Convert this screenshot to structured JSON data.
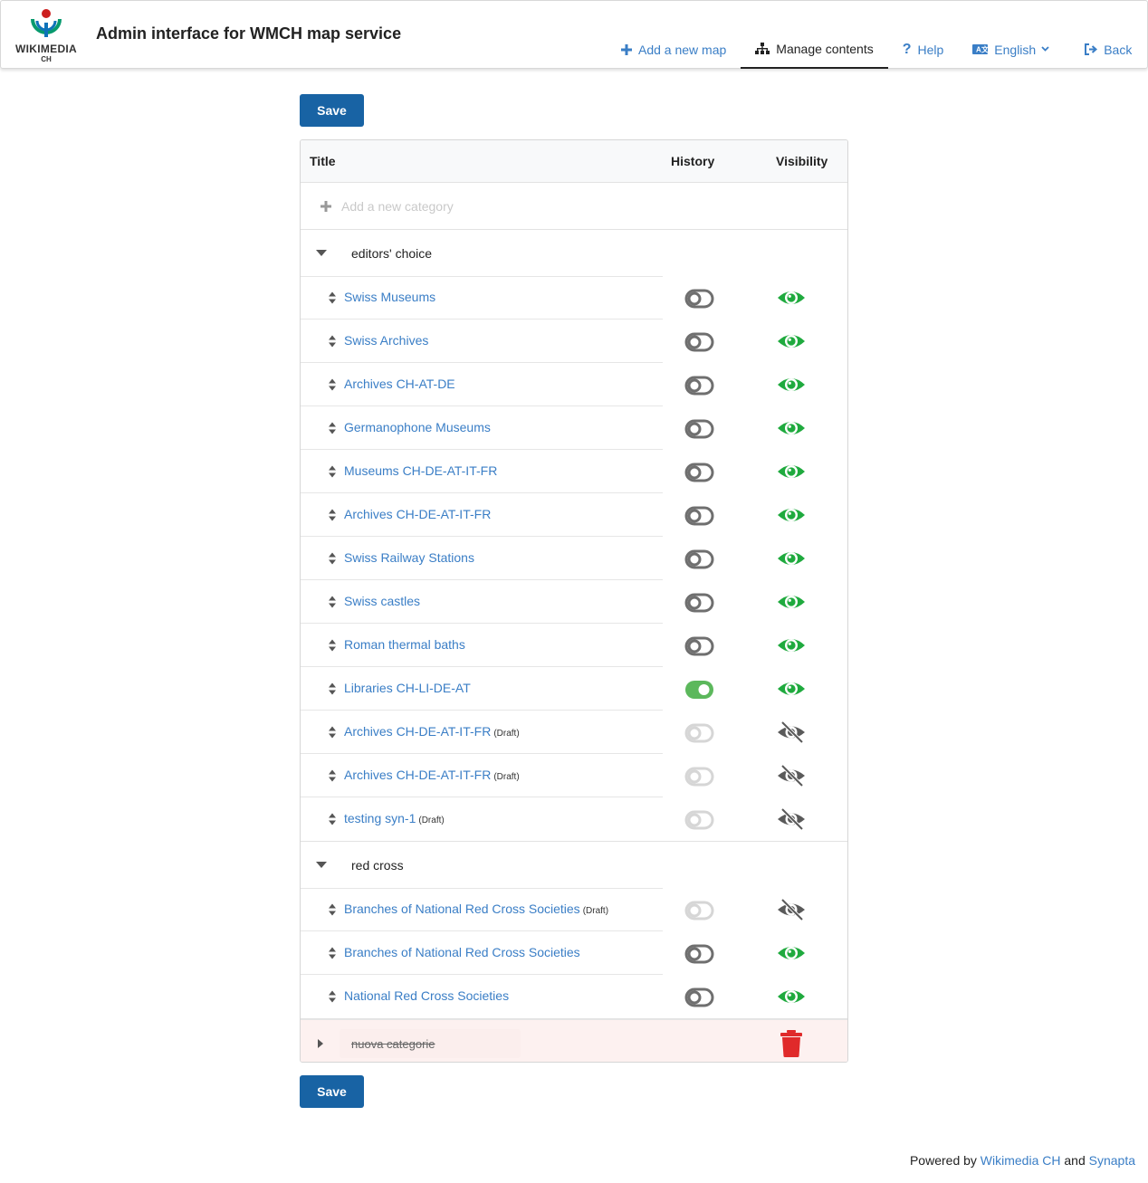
{
  "header": {
    "logo_text": "WIKIMEDIA",
    "logo_sub": "CH",
    "title": "Admin interface for WMCH map service",
    "nav": {
      "add_map": "Add a new map",
      "manage": "Manage contents",
      "help": "Help",
      "language": "English",
      "back": "Back"
    }
  },
  "save_label": "Save",
  "table": {
    "col_title": "Title",
    "col_history": "History",
    "col_visibility": "Visibility",
    "add_placeholder": "Add a new category"
  },
  "categories": [
    {
      "name": "editors' choice",
      "items": [
        {
          "title": "Swiss Museums",
          "draft": "",
          "history": "off",
          "visible": true
        },
        {
          "title": "Swiss Archives",
          "draft": "",
          "history": "off",
          "visible": true
        },
        {
          "title": "Archives CH-AT-DE",
          "draft": "",
          "history": "off",
          "visible": true
        },
        {
          "title": "Germanophone Museums",
          "draft": "",
          "history": "off",
          "visible": true
        },
        {
          "title": "Museums CH-DE-AT-IT-FR",
          "draft": "",
          "history": "off",
          "visible": true
        },
        {
          "title": "Archives CH-DE-AT-IT-FR",
          "draft": "",
          "history": "off",
          "visible": true
        },
        {
          "title": "Swiss Railway Stations",
          "draft": "",
          "history": "off",
          "visible": true
        },
        {
          "title": "Swiss castles",
          "draft": "",
          "history": "off",
          "visible": true
        },
        {
          "title": "Roman thermal baths",
          "draft": "",
          "history": "off",
          "visible": true
        },
        {
          "title": "Libraries CH-LI-DE-AT",
          "draft": "",
          "history": "on",
          "visible": true
        },
        {
          "title": "Archives CH-DE-AT-IT-FR",
          "draft": "(Draft)",
          "history": "disabled",
          "visible": false
        },
        {
          "title": "Archives CH-DE-AT-IT-FR",
          "draft": "(Draft)",
          "history": "disabled",
          "visible": false
        },
        {
          "title": "testing syn-1",
          "draft": "(Draft)",
          "history": "disabled",
          "visible": false
        }
      ]
    },
    {
      "name": "red cross",
      "items": [
        {
          "title": "Branches of National Red Cross Societies",
          "draft": "(Draft)",
          "history": "disabled",
          "visible": false
        },
        {
          "title": "Branches of National Red Cross Societies",
          "draft": "",
          "history": "off",
          "visible": true
        },
        {
          "title": "National Red Cross Societies",
          "draft": "",
          "history": "off",
          "visible": true
        }
      ]
    }
  ],
  "deleted_category": "nuova categorie",
  "footer": {
    "prefix": "Powered by",
    "link1": "Wikimedia CH",
    "and": "and",
    "link2": "Synapta"
  },
  "colors": {
    "accent": "#1863a4",
    "link": "#3a7ec6",
    "visible_green": "#1faa3e",
    "toggle_on": "#5cb85c",
    "delete_red": "#e02a2a"
  }
}
